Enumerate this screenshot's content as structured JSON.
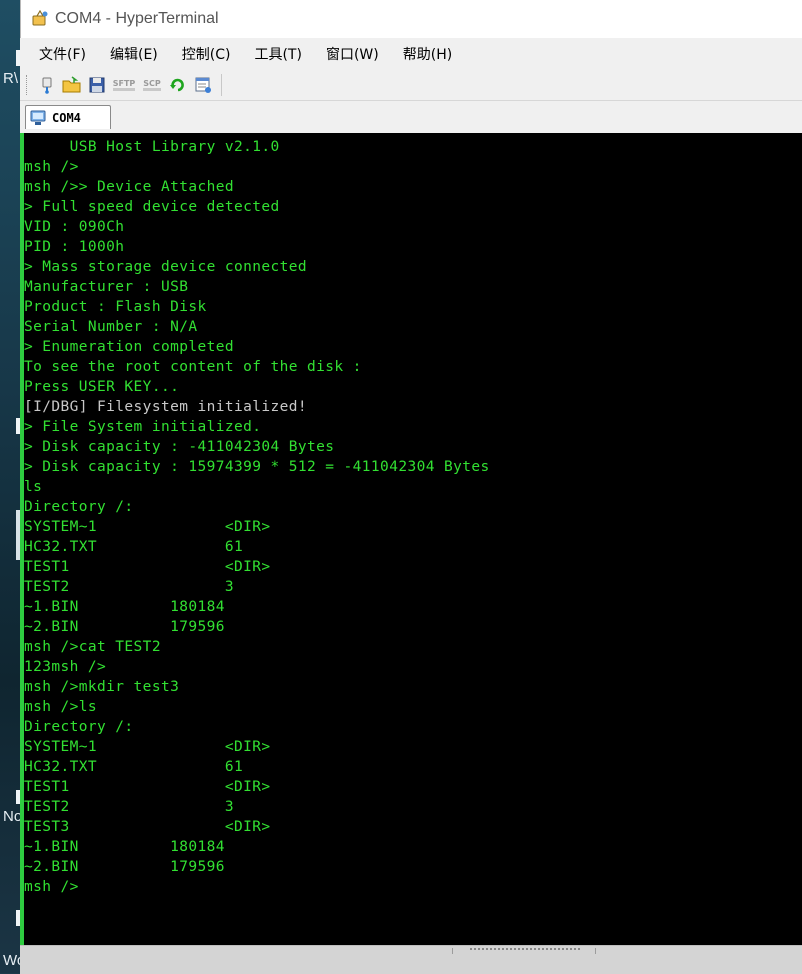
{
  "window": {
    "title": "COM4 - HyperTerminal"
  },
  "desktop": {
    "fragments": [
      "R\\",
      "No",
      "Wo"
    ]
  },
  "menu": {
    "items": [
      "文件(F)",
      "编辑(E)",
      "控制(C)",
      "工具(T)",
      "窗口(W)",
      "帮助(H)"
    ]
  },
  "toolbar": {
    "buttons": [
      {
        "icon": "new-connection-icon"
      },
      {
        "icon": "open-folder-icon"
      },
      {
        "icon": "save-icon"
      },
      {
        "label": "SFTP",
        "icon": "sftp-icon"
      },
      {
        "label": "SCP",
        "icon": "scp-icon"
      },
      {
        "icon": "reconnect-icon"
      },
      {
        "icon": "properties-icon"
      }
    ]
  },
  "tab": {
    "label": "COM4"
  },
  "terminal": {
    "lines": [
      {
        "text": "     USB Host Library v2.1.0",
        "color": "green"
      },
      {
        "text": "msh />",
        "color": "green"
      },
      {
        "text": "msh />> Device Attached",
        "color": "green"
      },
      {
        "text": "> Full speed device detected",
        "color": "green"
      },
      {
        "text": "VID : 090Ch",
        "color": "green"
      },
      {
        "text": "PID : 1000h",
        "color": "green"
      },
      {
        "text": "> Mass storage device connected",
        "color": "green"
      },
      {
        "text": "Manufacturer : USB",
        "color": "green"
      },
      {
        "text": "Product : Flash Disk",
        "color": "green"
      },
      {
        "text": "Serial Number : N/A",
        "color": "green"
      },
      {
        "text": "> Enumeration completed",
        "color": "green"
      },
      {
        "text": "To see the root content of the disk :",
        "color": "green"
      },
      {
        "text": "Press USER KEY...",
        "color": "green"
      },
      {
        "text": "[I/DBG] Filesystem initialized!",
        "color": "gray"
      },
      {
        "text": "> File System initialized.",
        "color": "green"
      },
      {
        "text": "> Disk capacity : -411042304 Bytes",
        "color": "green"
      },
      {
        "text": "> Disk capacity : 15974399 * 512 = -411042304 Bytes",
        "color": "green"
      },
      {
        "text": "ls",
        "color": "green"
      },
      {
        "text": "Directory /:",
        "color": "green"
      },
      {
        "text": "SYSTEM~1              <DIR>",
        "color": "green"
      },
      {
        "text": "HC32.TXT              61",
        "color": "green"
      },
      {
        "text": "TEST1                 <DIR>",
        "color": "green"
      },
      {
        "text": "TEST2                 3",
        "color": "green"
      },
      {
        "text": "~1.BIN          180184",
        "color": "green"
      },
      {
        "text": "~2.BIN          179596",
        "color": "green"
      },
      {
        "text": "msh />cat TEST2",
        "color": "green"
      },
      {
        "text": "123msh />",
        "color": "green"
      },
      {
        "text": "msh />mkdir test3",
        "color": "green"
      },
      {
        "text": "msh />ls",
        "color": "green"
      },
      {
        "text": "Directory /:",
        "color": "green"
      },
      {
        "text": "SYSTEM~1              <DIR>",
        "color": "green"
      },
      {
        "text": "HC32.TXT              61",
        "color": "green"
      },
      {
        "text": "TEST1                 <DIR>",
        "color": "green"
      },
      {
        "text": "TEST2                 3",
        "color": "green"
      },
      {
        "text": "TEST3                 <DIR>",
        "color": "green"
      },
      {
        "text": "~1.BIN          180184",
        "color": "green"
      },
      {
        "text": "~2.BIN          179596",
        "color": "green"
      },
      {
        "text": "msh />",
        "color": "green"
      }
    ]
  },
  "colors": {
    "terminal_bg": "#000000",
    "terminal_text": "#32e032",
    "terminal_debug_text": "#c8c8c8",
    "window_bg": "#f0f0f0"
  }
}
